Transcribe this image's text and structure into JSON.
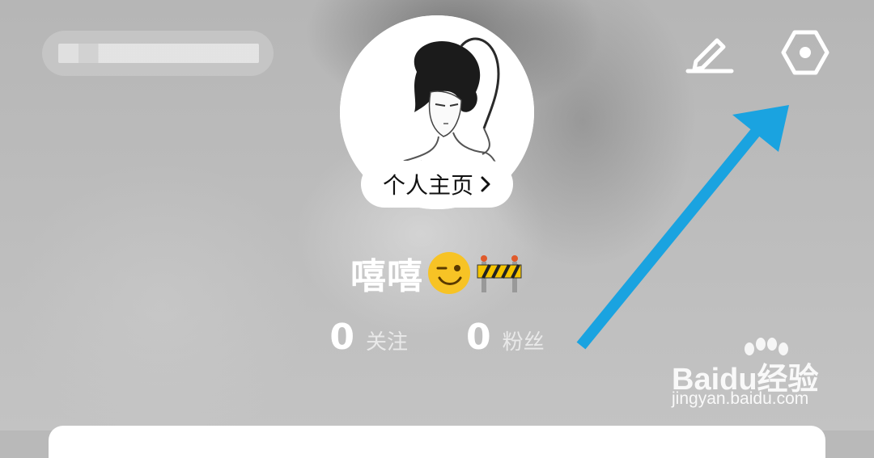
{
  "header": {
    "edit_icon": "pencil-icon",
    "settings_icon": "hexagon-settings-icon"
  },
  "profile": {
    "homepage_link_label": "个人主页",
    "chevron": "›",
    "nickname": "嘻嘻",
    "nickname_emojis": [
      "wink-emoji",
      "construction-barrier-emoji"
    ]
  },
  "stats": [
    {
      "value": "0",
      "label": "关注"
    },
    {
      "value": "0",
      "label": "粉丝"
    }
  ],
  "annotation": {
    "arrow_color": "#1aa3e0"
  },
  "watermark": {
    "brand": "Baidu经验",
    "url": "jingyan.baidu.com"
  }
}
